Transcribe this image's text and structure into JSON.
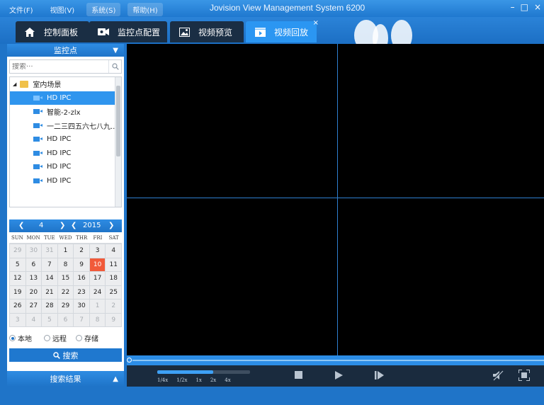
{
  "menu": [
    {
      "label": "文件(F)"
    },
    {
      "label": "视图(V)"
    },
    {
      "label": "系统(S)"
    },
    {
      "label": "帮助(H)"
    }
  ],
  "app_title": "Jovision View Management System 6200",
  "window_controls": {
    "minimize": "–",
    "maximize": "□",
    "close": "×"
  },
  "tabs": [
    {
      "label": "控制面板",
      "icon": "home-icon"
    },
    {
      "label": "监控点配置",
      "icon": "camera-config-icon"
    },
    {
      "label": "视频预览",
      "icon": "image-preview-icon"
    },
    {
      "label": "视频回放",
      "icon": "playback-icon",
      "active": true,
      "close": "×"
    }
  ],
  "monitor_panel": {
    "title": "监控点",
    "search_placeholder": "搜索···",
    "tree": {
      "root": "室内场景",
      "items": [
        "HD IPC",
        "智能-2-zlx",
        "一二三四五六七八九...",
        "HD IPC",
        "HD IPC",
        "HD IPC",
        "HD IPC"
      ],
      "selected_index": 0
    }
  },
  "calendar": {
    "month": "4",
    "year": "2015",
    "weekdays": [
      "SUN",
      "MON",
      "TUE",
      "WED",
      "THR",
      "FRI",
      "SAT"
    ],
    "days": [
      [
        "29",
        "30",
        "31",
        "1",
        "2",
        "3",
        "4"
      ],
      [
        "5",
        "6",
        "7",
        "8",
        "9",
        "10",
        "11"
      ],
      [
        "12",
        "13",
        "14",
        "15",
        "16",
        "17",
        "18"
      ],
      [
        "19",
        "20",
        "21",
        "22",
        "23",
        "24",
        "25"
      ],
      [
        "26",
        "27",
        "28",
        "29",
        "30",
        "1",
        "2"
      ],
      [
        "3",
        "4",
        "5",
        "6",
        "7",
        "8",
        "9"
      ]
    ],
    "today": "10"
  },
  "storage_options": [
    {
      "label": "本地",
      "selected": true
    },
    {
      "label": "远程",
      "selected": false
    },
    {
      "label": "存储",
      "selected": false
    }
  ],
  "search_button": "搜索",
  "results_title": "搜索结果",
  "playback": {
    "speeds": [
      "1/4x",
      "1/2x",
      "1x",
      "2x",
      "4x"
    ],
    "speed_progress": 0.6
  },
  "colors": {
    "accent": "#1f74c8",
    "active_tab": "#2b96f2",
    "today": "#f15a3a"
  }
}
